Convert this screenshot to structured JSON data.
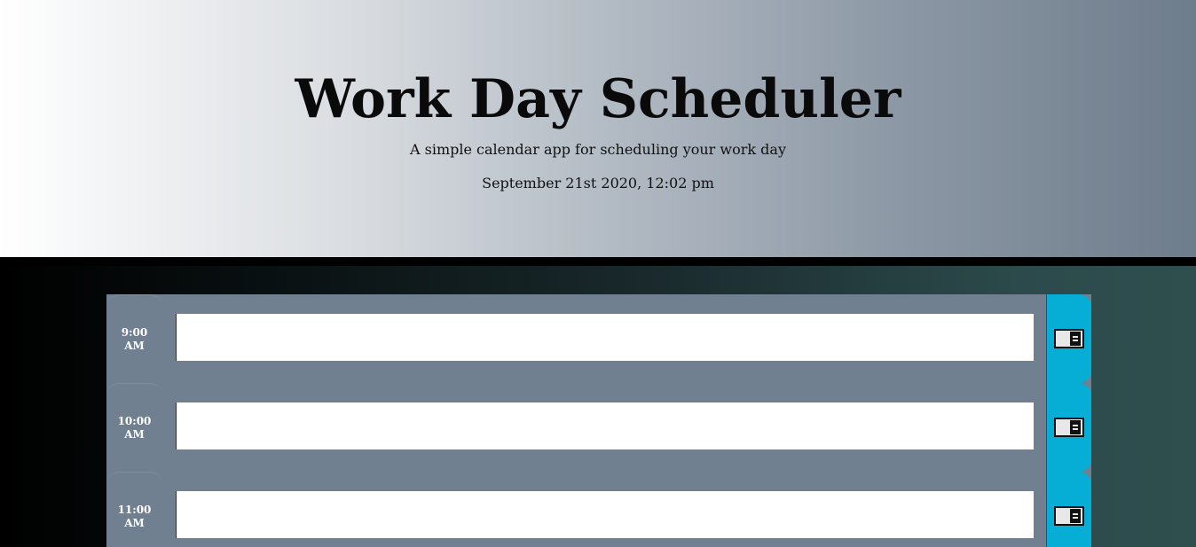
{
  "header": {
    "title": "Work Day Scheduler",
    "subtitle": "A simple calendar app for scheduling your work day",
    "current_day": "September 21st 2020, 12:02 pm"
  },
  "time_blocks": [
    {
      "hour_line1": "9:00",
      "hour_line2": "AM",
      "task": "",
      "save_icon": "save-icon"
    },
    {
      "hour_line1": "10:00",
      "hour_line2": "AM",
      "task": "",
      "save_icon": "save-icon"
    },
    {
      "hour_line1": "11:00",
      "hour_line2": "AM",
      "task": "",
      "save_icon": "save-icon"
    }
  ],
  "colors": {
    "row_background": "#708090",
    "save_button": "#06aed5",
    "textarea": "#ffffff"
  }
}
